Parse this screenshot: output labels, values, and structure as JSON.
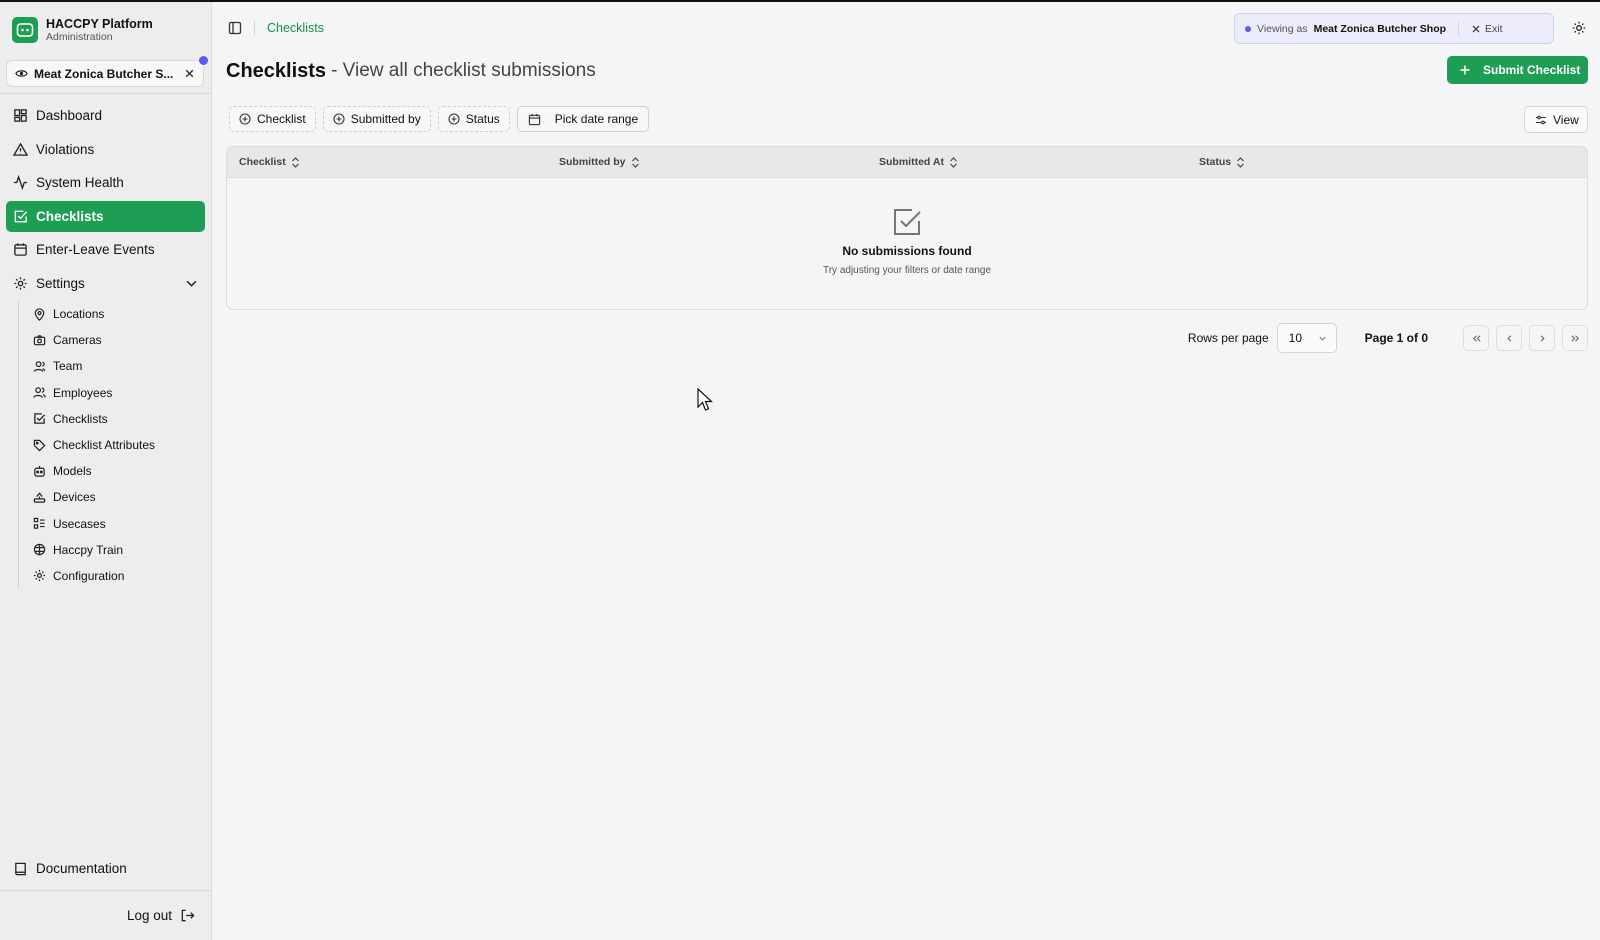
{
  "brand": {
    "title": "HACCPY Platform",
    "subtitle": "Administration",
    "color": "#1e9e55"
  },
  "org_switcher": {
    "label": "Meat Zonica Butcher S..."
  },
  "nav": {
    "items": [
      {
        "label": "Dashboard",
        "icon": "dashboard-icon"
      },
      {
        "label": "Violations",
        "icon": "warning-triangle-icon"
      },
      {
        "label": "System Health",
        "icon": "pulse-icon"
      },
      {
        "label": "Checklists",
        "icon": "check-square-icon",
        "active": true
      },
      {
        "label": "Enter-Leave Events",
        "icon": "calendar-icon"
      },
      {
        "label": "Settings",
        "icon": "gear-icon",
        "expanded": true
      }
    ],
    "settings_items": [
      {
        "label": "Locations",
        "icon": "map-pin-icon"
      },
      {
        "label": "Cameras",
        "icon": "camera-icon"
      },
      {
        "label": "Team",
        "icon": "user-icon"
      },
      {
        "label": "Employees",
        "icon": "users-icon"
      },
      {
        "label": "Checklists",
        "icon": "check-square-icon"
      },
      {
        "label": "Checklist Attributes",
        "icon": "tag-icon"
      },
      {
        "label": "Models",
        "icon": "bot-icon"
      },
      {
        "label": "Devices",
        "icon": "device-icon"
      },
      {
        "label": "Usecases",
        "icon": "list-icon"
      },
      {
        "label": "Haccpy Train",
        "icon": "brain-icon"
      },
      {
        "label": "Configuration",
        "icon": "gear-icon"
      }
    ],
    "documentation": "Documentation",
    "logout": "Log out"
  },
  "topbar": {
    "breadcrumb": "Checklists",
    "viewing_prefix": "Viewing as",
    "viewing_org": "Meat Zonica Butcher Shop",
    "exit_label": "Exit"
  },
  "page": {
    "title": "Checklists",
    "subtitle": "- View all checklist submissions",
    "submit_label": "Submit Checklist"
  },
  "filters": {
    "checklist": "Checklist",
    "submitted_by": "Submitted by",
    "status": "Status",
    "date_range": "Pick date range",
    "view": "View"
  },
  "table": {
    "columns": [
      "Checklist",
      "Submitted by",
      "Submitted At",
      "Status"
    ],
    "empty_title": "No submissions found",
    "empty_subtitle": "Try adjusting your filters or date range"
  },
  "pagination": {
    "rows_per_page_label": "Rows per page",
    "rows_per_page_value": "10",
    "page_info": "Page 1 of 0"
  }
}
